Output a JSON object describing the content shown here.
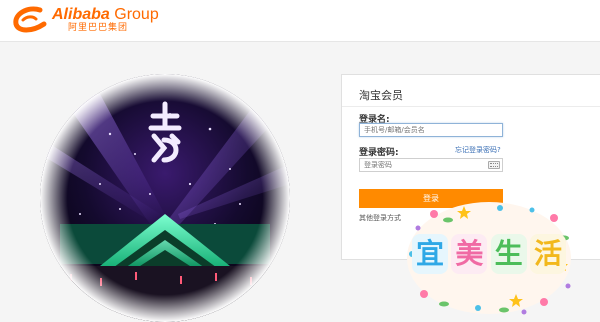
{
  "header": {
    "logo_brand": "Alibaba",
    "logo_group": "Group",
    "logo_cn": "阿里巴巴集团"
  },
  "login": {
    "title": "淘宝会员",
    "username_label": "登录名:",
    "username_placeholder": "手机号/邮箱/会员名",
    "password_label": "登录密码:",
    "forgot_link": "忘记登录密码?",
    "password_placeholder": "登录密码",
    "submit_label": "登录",
    "other_login": "其他登录方式"
  },
  "sticker": {
    "chars": [
      "宜",
      "美",
      "生",
      "活"
    ],
    "char_colors": [
      "#2fa8e6",
      "#f06aa4",
      "#4cbd5a",
      "#f2b81c"
    ]
  },
  "colors": {
    "brand_orange": "#ff6a00",
    "button_orange": "#ff8a00",
    "link_blue": "#3a6fb5"
  }
}
